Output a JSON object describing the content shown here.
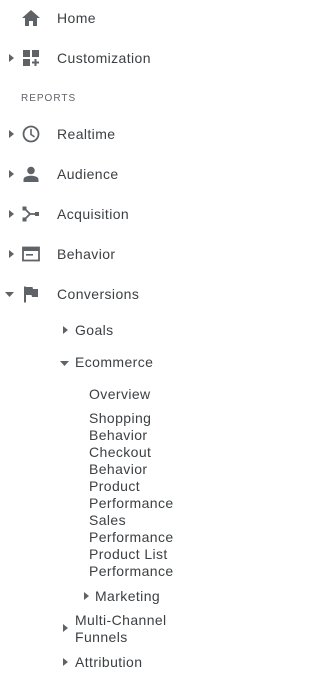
{
  "nav": {
    "home": {
      "label": "Home",
      "icon": "home-icon"
    },
    "customization": {
      "label": "Customization",
      "icon": "dashboard-plus-icon"
    },
    "reports_section": "REPORTS",
    "realtime": {
      "label": "Realtime",
      "icon": "clock-icon"
    },
    "audience": {
      "label": "Audience",
      "icon": "person-icon"
    },
    "acquisition": {
      "label": "Acquisition",
      "icon": "branch-icon"
    },
    "behavior": {
      "label": "Behavior",
      "icon": "browser-window-icon"
    },
    "conversions": {
      "label": "Conversions",
      "icon": "flag-icon"
    },
    "goals": {
      "label": "Goals"
    },
    "ecommerce": {
      "label": "Ecommerce"
    },
    "overview": {
      "label": "Overview"
    },
    "shopping_behavior": {
      "label": "Shopping Behavior"
    },
    "checkout_behavior": {
      "label": "Checkout Behavior"
    },
    "product_performance": {
      "label": "Product Performance"
    },
    "sales_performance": {
      "label": "Sales Performance"
    },
    "product_list_performance": {
      "label": "Product List Performance"
    },
    "marketing": {
      "label": "Marketing"
    },
    "multi_channel_funnels": {
      "label": "Multi-Channel Funnels"
    },
    "attribution": {
      "label": "Attribution"
    }
  },
  "colors": {
    "icon": "#5f6368",
    "text": "#3c4043",
    "section": "#5f6368"
  }
}
